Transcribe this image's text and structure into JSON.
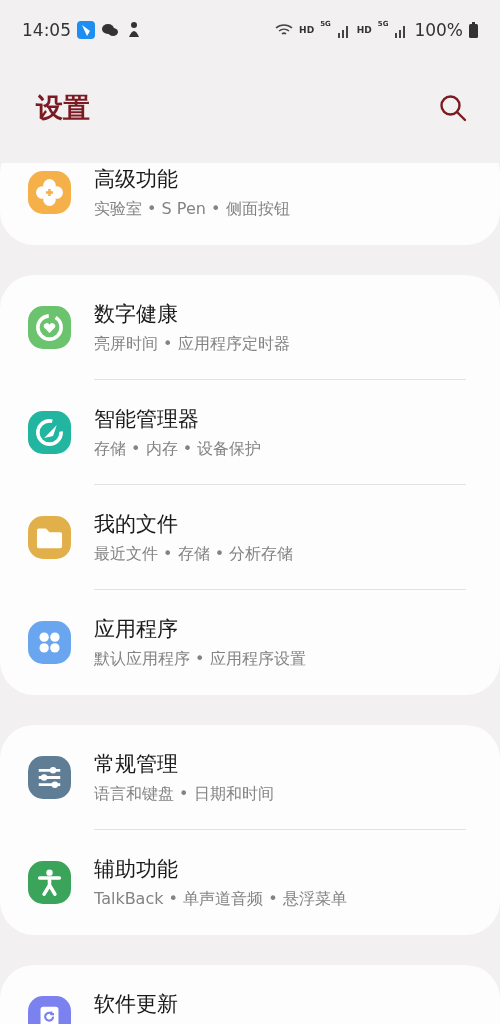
{
  "status_bar": {
    "time": "14:05",
    "signals": [
      {
        "tag": "HD",
        "network": "5G"
      },
      {
        "tag": "HD",
        "network": "5G"
      }
    ],
    "battery": "100%"
  },
  "header": {
    "title": "设置"
  },
  "groups": [
    {
      "items": [
        {
          "kind": "advanced",
          "color": "#f5b04a",
          "title": "高级功能",
          "subtitle": "实验室 • S Pen • 侧面按钮"
        }
      ]
    },
    {
      "items": [
        {
          "kind": "wellbeing",
          "color": "#6cc36e",
          "title": "数字健康",
          "subtitle": "亮屏时间 • 应用程序定时器"
        },
        {
          "kind": "care",
          "color": "#22b5a0",
          "title": "智能管理器",
          "subtitle": "存储 • 内存 • 设备保护"
        },
        {
          "kind": "folder",
          "color": "#e2b04a",
          "title": "我的文件",
          "subtitle": "最近文件 • 存储 • 分析存储"
        },
        {
          "kind": "apps",
          "color": "#6aa6f0",
          "title": "应用程序",
          "subtitle": "默认应用程序 • 应用程序设置"
        }
      ]
    },
    {
      "items": [
        {
          "kind": "sliders",
          "color": "#5f7e96",
          "title": "常规管理",
          "subtitle": "语言和键盘 • 日期和时间"
        },
        {
          "kind": "accessibility",
          "color": "#3aa45a",
          "title": "辅助功能",
          "subtitle": "TalkBack • 单声道音频 • 悬浮菜单"
        }
      ]
    },
    {
      "items": [
        {
          "kind": "update",
          "color": "#7b82f0",
          "title": "软件更新"
        }
      ]
    }
  ]
}
